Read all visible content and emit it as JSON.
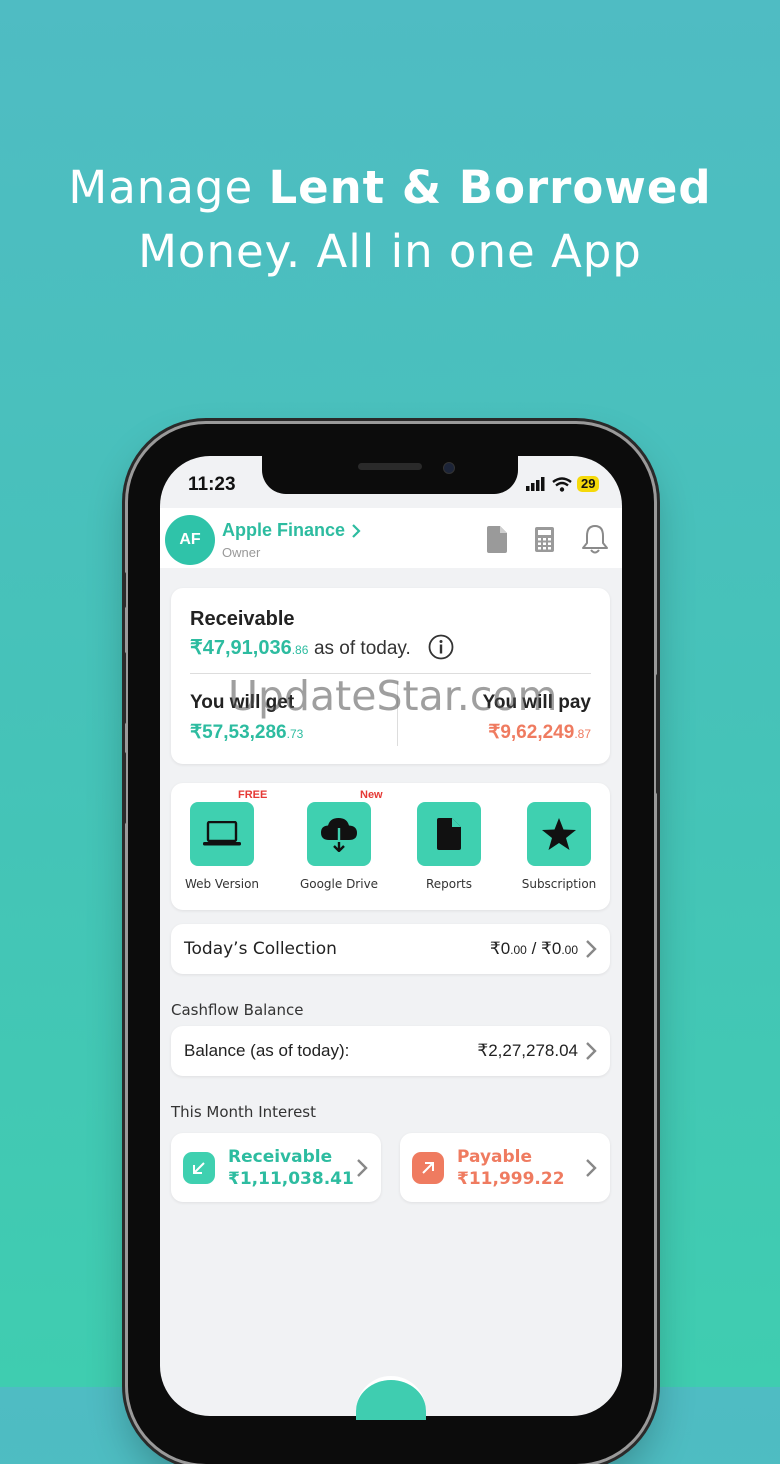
{
  "headline": {
    "line1_regular": "Manage ",
    "line1_bold": "Lent & Borrowed",
    "line2": "Money. All in one App"
  },
  "status_bar": {
    "time": "11:23",
    "battery": "29"
  },
  "header": {
    "avatar_initials": "AF",
    "business_name": "Apple Finance",
    "role": "Owner"
  },
  "summary": {
    "title": "Receivable",
    "total_main": "₹47,91,036",
    "total_decimal": ".86",
    "total_suffix": "as of today.",
    "get_label": "You will get",
    "get_main": "₹57,53,286",
    "get_decimal": ".73",
    "pay_label": "You will pay",
    "pay_main": "₹9,62,249",
    "pay_decimal": ".87"
  },
  "quick_actions": [
    {
      "label": "Web Version",
      "badge": "FREE",
      "icon": "laptop-icon"
    },
    {
      "label": "Google Drive",
      "badge": "New",
      "icon": "cloud-download-icon"
    },
    {
      "label": "Reports",
      "badge": "",
      "icon": "document-icon"
    },
    {
      "label": "Subscription",
      "badge": "",
      "icon": "star-icon"
    }
  ],
  "todays_collection": {
    "label": "Today’s Collection",
    "v1_main": "₹0",
    "v1_dec": ".00",
    "sep": " / ",
    "v2_main": "₹0",
    "v2_dec": ".00"
  },
  "cashflow": {
    "section_title": "Cashflow Balance",
    "label": "Balance (as of today):",
    "value": "₹2,27,278.04"
  },
  "interest": {
    "section_title": "This Month Interest",
    "receivable_label": "Receivable",
    "receivable_value": "₹1,11,038.41",
    "payable_label": "Payable",
    "payable_value": "₹11,999.22"
  },
  "watermark": "UpdateStar.com",
  "colors": {
    "accent": "#2dbca0",
    "tile": "#3fd0b0",
    "payable": "#ef7b60",
    "badge": "#e53935"
  }
}
